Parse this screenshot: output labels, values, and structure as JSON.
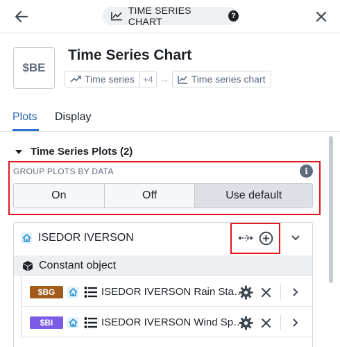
{
  "topbar": {
    "pill_label": "TIME SERIES CHART",
    "help_glyph": "?"
  },
  "header": {
    "avatar_text": "$BE",
    "title": "Time Series Chart",
    "crumbs": {
      "source_label": "Time series",
      "extra_count": "+4",
      "target_label": "Time series chart"
    }
  },
  "tabs": [
    {
      "label": "Plots",
      "active": true
    },
    {
      "label": "Display",
      "active": false
    }
  ],
  "plots_section": {
    "title": "Time Series Plots (2)",
    "group_by": {
      "label": "GROUP PLOTS BY DATA",
      "options": [
        "On",
        "Off",
        "Use default"
      ],
      "selected": "Use default"
    },
    "group": {
      "name": "ISEDOR IVERSON",
      "constant_label": "Constant object",
      "plots": [
        {
          "tag": "$BG",
          "tag_color": "#a35a1b",
          "name": "ISEDOR IVERSON Rain Sta…"
        },
        {
          "tag": "$BI",
          "tag_color": "#7c5ce6",
          "name": "ISEDOR IVERSON Wind Sp…"
        }
      ]
    }
  },
  "colors": {
    "accent": "#2d72d2",
    "highlight_outline": "#e4151d",
    "home_icon": "#2d94d2"
  },
  "icons": {
    "back": "arrow-left-icon",
    "close": "close-icon",
    "chart": "line-chart-icon",
    "home": "home-icon",
    "list": "list-icon",
    "cube": "cube-icon",
    "gear": "gear-icon",
    "remove": "x-icon",
    "add": "plus-circle-icon",
    "link": "link-data-icon",
    "expand": "chevron-icon"
  }
}
